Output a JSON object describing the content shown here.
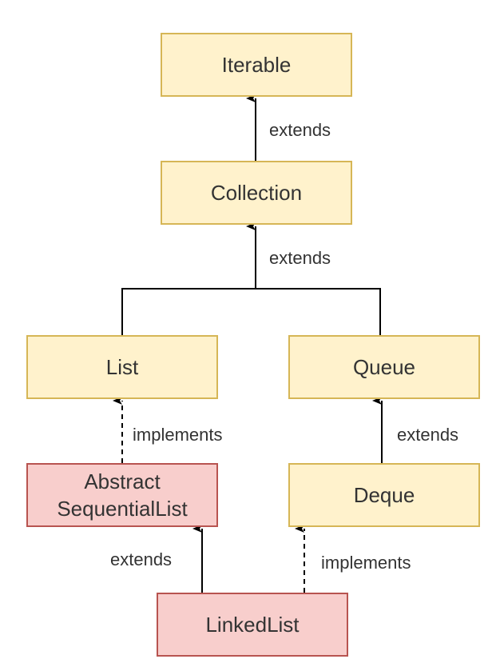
{
  "colors": {
    "interface_fill": "#fff2cc",
    "interface_stroke": "#d6b656",
    "class_fill": "#f8cecc",
    "class_stroke": "#b85450",
    "edge": "#000000"
  },
  "nodes": {
    "iterable": "Iterable",
    "collection": "Collection",
    "list": "List",
    "queue": "Queue",
    "abstract_sequential_list": "Abstract\nSequentialList",
    "deque": "Deque",
    "linked_list": "LinkedList"
  },
  "edges": {
    "collection_iterable": "extends",
    "list_queue_collection": "extends",
    "abstract_list": "implements",
    "deque_queue": "extends",
    "linkedlist_abstract": "extends",
    "linkedlist_deque": "implements"
  }
}
